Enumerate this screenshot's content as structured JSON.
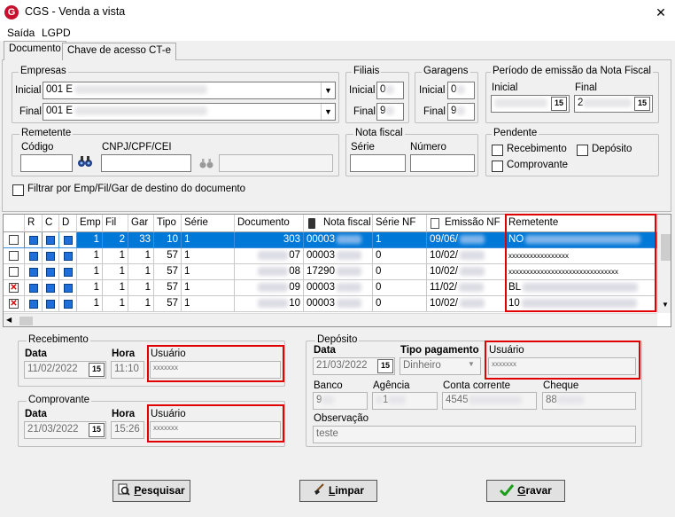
{
  "window": {
    "title": "CGS - Venda a vista",
    "logo": "G",
    "close_glyph": "✕"
  },
  "menu": {
    "items": [
      "Saída",
      "LGPD"
    ]
  },
  "tabs": {
    "items": [
      "Documento",
      "Chave de acesso CT-e"
    ]
  },
  "empresas": {
    "title": "Empresas",
    "inicial_label": "Inicial",
    "inicial_value": "001 E",
    "final_label": "Final",
    "final_value": "001 E"
  },
  "filiais": {
    "title": "Filiais",
    "inicial_label": "Inicial",
    "inicial_value": "0",
    "final_label": "Final",
    "final_value": "9"
  },
  "garagens": {
    "title": "Garagens",
    "inicial_label": "Inicial",
    "inicial_value": "0",
    "final_label": "Final",
    "final_value": "9"
  },
  "periodo": {
    "title": "Período de emissão da Nota Fiscal",
    "inicial_label": "Inicial",
    "final_label": "Final",
    "final_value": "2",
    "cal_icon_text": "15"
  },
  "remetente": {
    "title": "Remetente",
    "codigo_label": "Código",
    "cnpj_label": "CNPJ/CPF/CEI"
  },
  "nota_fiscal": {
    "title": "Nota fiscal",
    "serie_label": "Série",
    "numero_label": "Número"
  },
  "pendente": {
    "title": "Pendente",
    "recebimento_label": "Recebimento",
    "deposito_label": "Depósito",
    "comprovante_label": "Comprovante"
  },
  "filter_checkbox_label": "Filtrar por Emp/Fil/Gar de destino do documento",
  "grid": {
    "headers": [
      "",
      "R",
      "C",
      "D",
      "Emp",
      "Fil",
      "Gar",
      "Tipo",
      "Série",
      "Documento",
      "Nota fiscal",
      "Série NF",
      "Emissão NF",
      "Remetente"
    ],
    "rows": [
      {
        "sel": "empty",
        "emp": "1",
        "fil": "2",
        "gar": "33",
        "tipo": "10",
        "serie": "1",
        "doc": "303",
        "nf": "00003",
        "serienf": "1",
        "emissao": "09/06/",
        "remetente": "NO"
      },
      {
        "sel": "empty",
        "emp": "1",
        "fil": "1",
        "gar": "1",
        "tipo": "57",
        "serie": "1",
        "doc": "07",
        "nf": "00003",
        "serienf": "0",
        "emissao": "10/02/",
        "remetente": "xxxxxxxxxxxxxxxxx"
      },
      {
        "sel": "empty",
        "emp": "1",
        "fil": "1",
        "gar": "1",
        "tipo": "57",
        "serie": "1",
        "doc": "08",
        "nf": "17290",
        "serienf": "0",
        "emissao": "10/02/",
        "remetente": "xxxxxxxxxxxxxxxxxxxxxxxxxxxxxxx"
      },
      {
        "sel": "x",
        "emp": "1",
        "fil": "1",
        "gar": "1",
        "tipo": "57",
        "serie": "1",
        "doc": "09",
        "nf": "00003",
        "serienf": "0",
        "emissao": "11/02/",
        "remetente": "BL"
      },
      {
        "sel": "x",
        "emp": "1",
        "fil": "1",
        "gar": "1",
        "tipo": "57",
        "serie": "1",
        "doc": "10",
        "nf": "00003",
        "serienf": "0",
        "emissao": "10/02/",
        "remetente": "10"
      }
    ]
  },
  "recebimento": {
    "title": "Recebimento",
    "data_label": "Data",
    "data_value": "11/02/2022",
    "hora_label": "Hora",
    "hora_value": "11:10",
    "usuario_label": "Usuário",
    "usuario_value": "xxxxxxx"
  },
  "comprovante": {
    "title": "Comprovante",
    "data_label": "Data",
    "data_value": "21/03/2022",
    "hora_label": "Hora",
    "hora_value": "15:26",
    "usuario_label": "Usuário",
    "usuario_value": "xxxxxxx"
  },
  "deposito": {
    "title": "Depósito",
    "data_label": "Data",
    "data_value": "21/03/2022",
    "tipo_label": "Tipo pagamento",
    "tipo_value": "Dinheiro",
    "usuario_label": "Usuário",
    "usuario_value": "xxxxxxx",
    "banco_label": "Banco",
    "banco_value": "9",
    "agencia_label": "Agência",
    "agencia_value": "1",
    "conta_label": "Conta corrente",
    "conta_value": "4545",
    "cheque_label": "Cheque",
    "cheque_value": "88",
    "obs_label": "Observação",
    "obs_value": "teste"
  },
  "buttons": {
    "pesquisar_first": "P",
    "pesquisar_rest": "esquisar",
    "limpar_first": "L",
    "limpar_rest": "impar",
    "gravar_first": "G",
    "gravar_rest": "ravar"
  },
  "colors": {
    "selection": "#0078d7",
    "highlight": "#e00000",
    "checkbox_fill": "#1e6fd9",
    "save_check": "#1a9e1a"
  }
}
